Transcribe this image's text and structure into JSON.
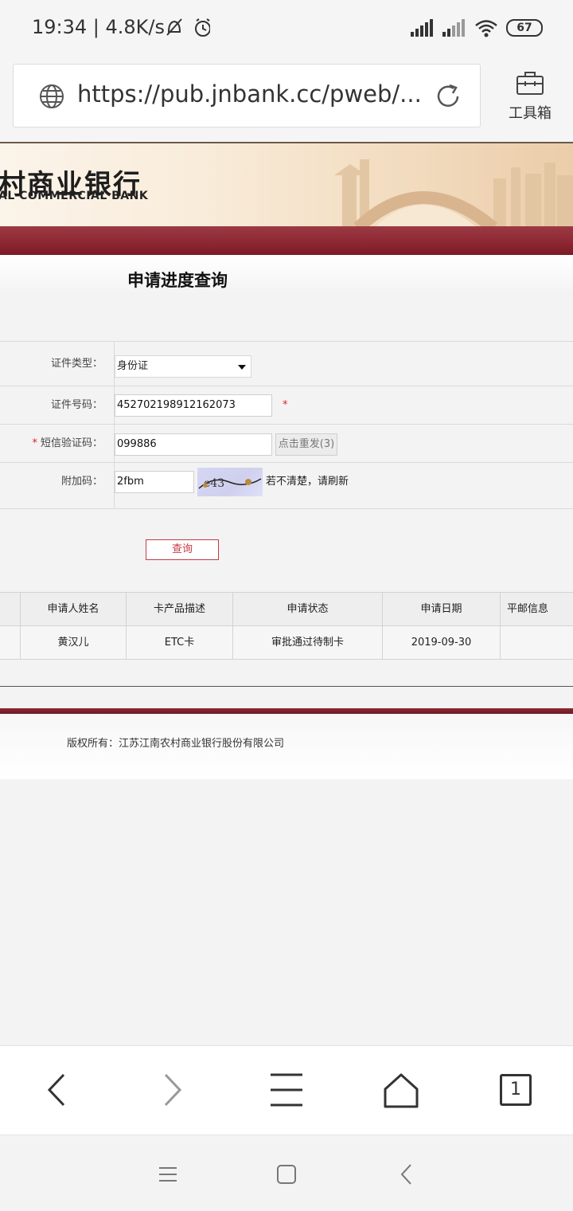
{
  "status_bar": {
    "time": "19:34",
    "speed": "4.8K/s",
    "battery": "67"
  },
  "browser": {
    "url": "https://pub.jnbank.cc/pweb/...",
    "toolbox_label": "工具箱"
  },
  "banner": {
    "name_cn": "村商业银行",
    "name_en": "AL COMMERCIAL BANK"
  },
  "page": {
    "title": "申请进度查询"
  },
  "form": {
    "id_type_label": "证件类型：",
    "id_type_value": "身份证",
    "id_number_label": "证件号码：",
    "id_number_value": "452702198912162073",
    "required_mark": "*",
    "sms_label": "短信验证码：",
    "sms_value": "099886",
    "resend_label": "点击重发(3)",
    "extra_label": "附加码：",
    "extra_value": "2fbm",
    "captcha_text": "e43",
    "captcha_hint": "若不清楚，请刷新",
    "query_button": "查询"
  },
  "results": {
    "headers": [
      "申请人姓名",
      "卡产品描述",
      "申请状态",
      "申请日期",
      "平邮信息"
    ],
    "rows": [
      [
        "黄汉儿",
        "ETC卡",
        "审批通过待制卡",
        "2019-09-30",
        ""
      ]
    ]
  },
  "footer": {
    "copyright": "版权所有：江苏江南农村商业银行股份有限公司"
  },
  "nav": {
    "tabs_count": "1"
  },
  "colors": {
    "brand_red": "#8e2833",
    "button_red": "#c63a44"
  }
}
